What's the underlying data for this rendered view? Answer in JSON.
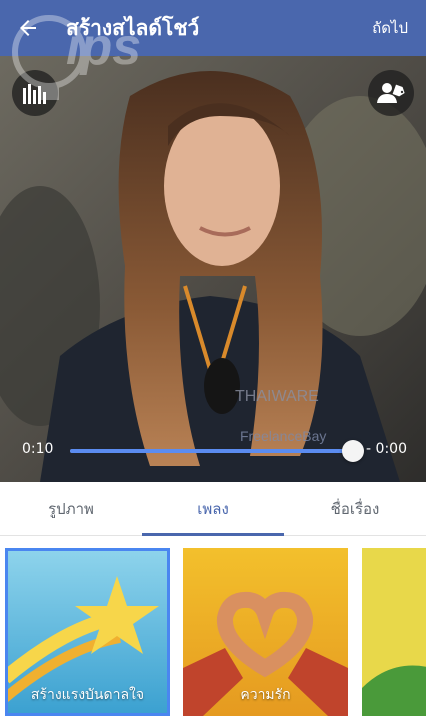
{
  "header": {
    "title": "สร้างสไลด์โชว์",
    "next_label": "ถัดไป",
    "back_icon": "arrow-left-icon"
  },
  "player": {
    "elapsed": "0:10",
    "remaining": "- 0:00",
    "progress": 1.0
  },
  "tabs": [
    {
      "label": "รูปภาพ",
      "active": false
    },
    {
      "label": "เพลง",
      "active": true
    },
    {
      "label": "ชื่อเรื่อง",
      "active": false
    }
  ],
  "music": [
    {
      "label": "สร้างแรงบันดาลใจ",
      "selected": true,
      "icon": "shooting-star-icon"
    },
    {
      "label": "ความรัก",
      "selected": false,
      "icon": "heart-hands-icon"
    },
    {
      "label": "",
      "selected": false,
      "icon": "partial-card"
    }
  ],
  "colors": {
    "header_bg": "#4a67ad",
    "accent": "#4a86f0",
    "tab_active": "#4a67ad"
  }
}
